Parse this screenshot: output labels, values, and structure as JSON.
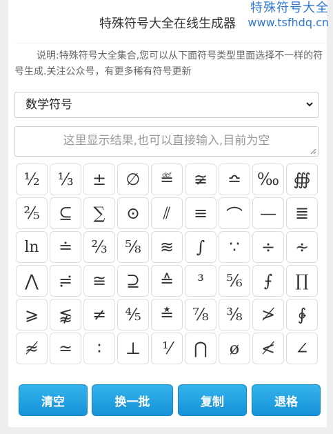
{
  "watermark": {
    "line1": "特殊符号大全",
    "line2": "www.tsfhdq.cn"
  },
  "header": {
    "title": "特殊符号大全在线生成器"
  },
  "description": "说明:特殊符号大全集合,您可以从下面符号类型里面选择不一样的符号生成.关注公众号，有更多稀有符号更新",
  "category_select": {
    "selected": "数学符号"
  },
  "result_box": {
    "placeholder": "这里显示结果,也可以直接输入,目前为空"
  },
  "symbols": [
    "½",
    "⅓",
    "±",
    "∅",
    "≝",
    "≆",
    "≏",
    "‰",
    "∰",
    "⅖",
    "⊆",
    "∑",
    "⊙",
    "⫽",
    "≡",
    "⌒",
    "—",
    "≣",
    "ln",
    "≐",
    "⅔",
    "⅝",
    "≋",
    "∫",
    "∵",
    "÷",
    "∻",
    "⋀",
    "≓",
    "≅",
    "⊇",
    "≙",
    "³",
    "⅚",
    "⨍",
    "∏",
    "⩾",
    "⪉",
    "≠",
    "⅘",
    "≛",
    "⅞",
    "⅜",
    "≯",
    "∲",
    "≉",
    "≃",
    "∶",
    "⊥",
    "⅟",
    "⋂",
    "ø",
    "≮",
    "∠"
  ],
  "actions": {
    "clear": "清空",
    "next_batch": "换一批",
    "copy": "复制",
    "backspace": "退格"
  }
}
